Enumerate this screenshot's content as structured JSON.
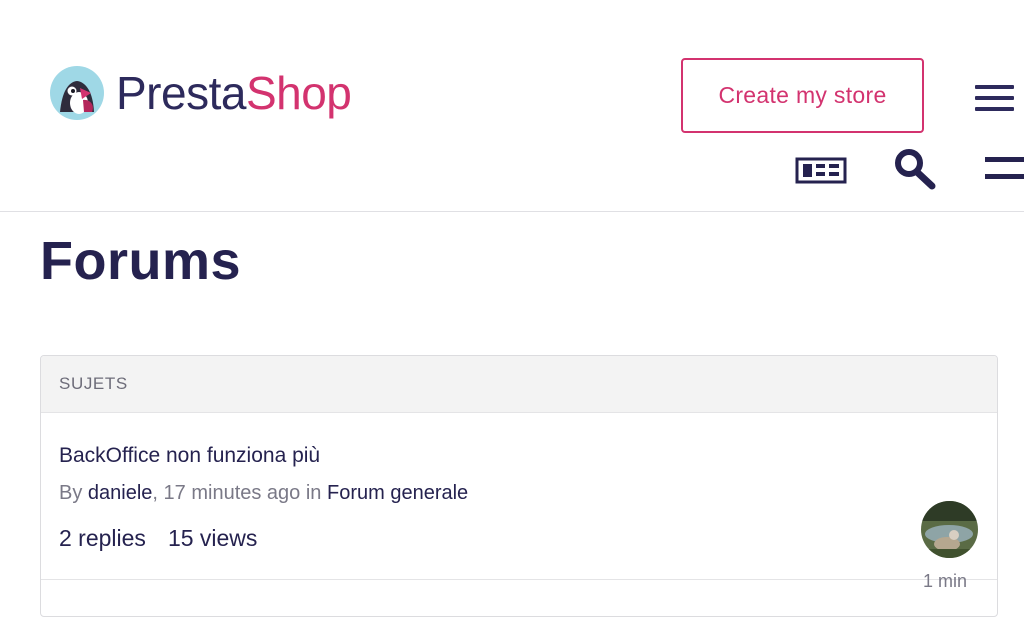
{
  "header": {
    "logo": {
      "part1": "Presta",
      "part2": "Shop"
    },
    "cta_label": "Create my store",
    "icons": [
      "logo-icon",
      "hamburger-menu-icon",
      "news-icon",
      "search-icon",
      "menu-icon"
    ]
  },
  "page": {
    "title": "Forums"
  },
  "forum": {
    "column_header": "SUJETS",
    "topics": [
      {
        "title": "BackOffice non funziona più",
        "by_label": "By",
        "author": "daniele",
        "time_ago": ", 17 minutes ago in",
        "forum": "Forum generale",
        "replies": "2 replies",
        "views": "15 views",
        "last_activity": "1 min"
      }
    ]
  },
  "colors": {
    "brand_navy": "#25224f",
    "brand_pink": "#d3336f",
    "muted_text": "#7a7987",
    "panel_header_bg": "#f3f3f3"
  }
}
